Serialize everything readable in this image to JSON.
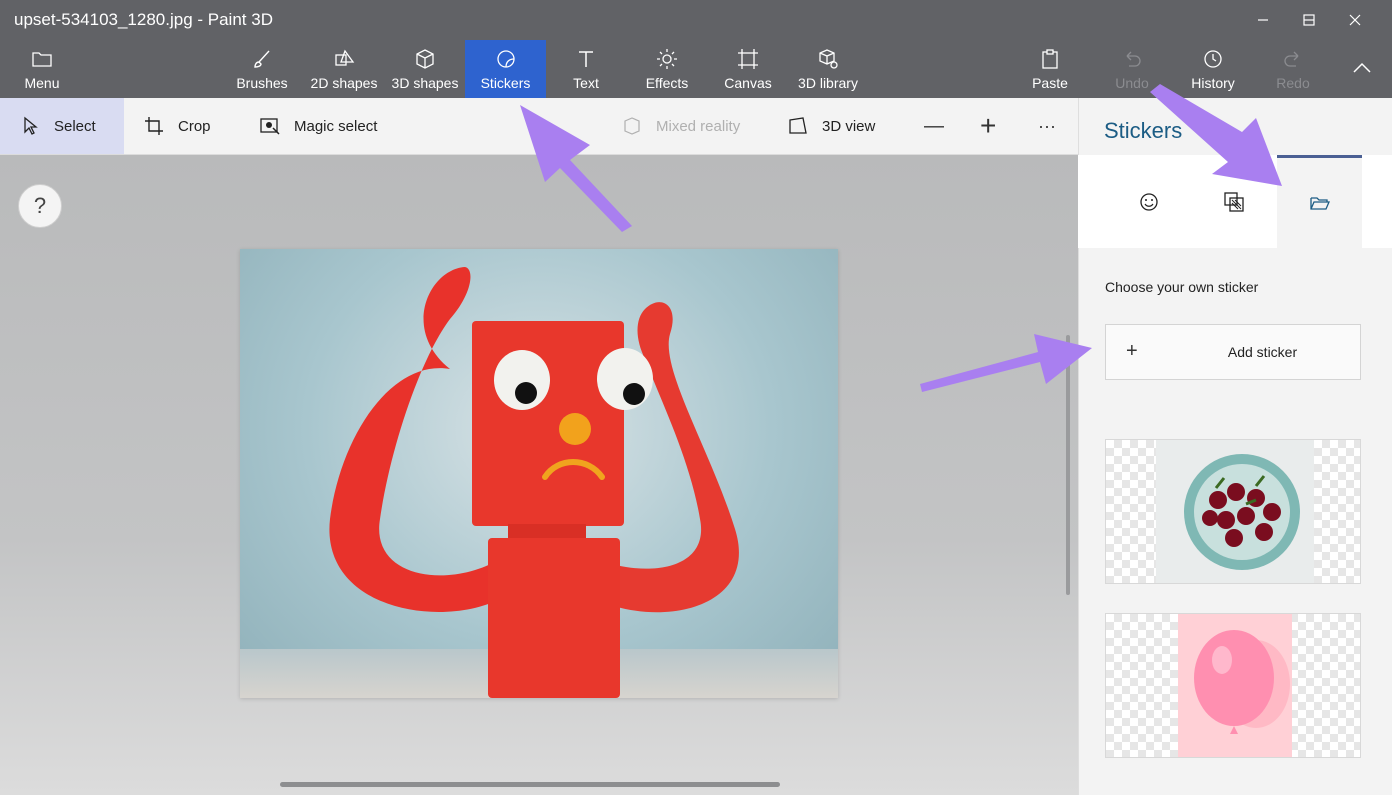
{
  "window": {
    "title": "upset-534103_1280.jpg - Paint 3D",
    "controls": [
      "minimize",
      "maximize",
      "close"
    ]
  },
  "ribbon": {
    "menu_label": "Menu",
    "tools": [
      {
        "label": "Brushes",
        "icon": "brush-icon"
      },
      {
        "label": "2D shapes",
        "icon": "2d-shapes-icon"
      },
      {
        "label": "3D shapes",
        "icon": "3d-shapes-icon"
      },
      {
        "label": "Stickers",
        "icon": "stickers-icon",
        "active": true
      },
      {
        "label": "Text",
        "icon": "text-icon"
      },
      {
        "label": "Effects",
        "icon": "effects-icon"
      },
      {
        "label": "Canvas",
        "icon": "canvas-icon"
      },
      {
        "label": "3D library",
        "icon": "3d-library-icon"
      }
    ],
    "right_tools": [
      {
        "label": "Paste",
        "icon": "paste-icon"
      },
      {
        "label": "Undo",
        "icon": "undo-icon",
        "disabled": true
      },
      {
        "label": "History",
        "icon": "history-icon"
      },
      {
        "label": "Redo",
        "icon": "redo-icon",
        "disabled": true
      }
    ]
  },
  "toolbar": {
    "select_label": "Select",
    "crop_label": "Crop",
    "magic_select_label": "Magic select",
    "mixed_reality_label": "Mixed reality",
    "view_3d_label": "3D view",
    "zoom_out": "—",
    "zoom_in": "+",
    "more": "···"
  },
  "help": {
    "label": "?"
  },
  "panel": {
    "title": "Stickers",
    "tabs": [
      {
        "icon": "sticker-face-icon"
      },
      {
        "icon": "textures-icon"
      },
      {
        "icon": "folder-open-icon",
        "active": true
      }
    ],
    "choose_label": "Choose your own sticker",
    "add_plus": "+",
    "add_label": "Add sticker",
    "stickers": [
      {
        "name": "cherries-bowl"
      },
      {
        "name": "pink-balloon"
      }
    ]
  },
  "colors": {
    "chrome": "#616266",
    "active_tool": "#2e63cf",
    "panel_title": "#1b5c84",
    "annotation_arrow": "#a97ff0"
  }
}
